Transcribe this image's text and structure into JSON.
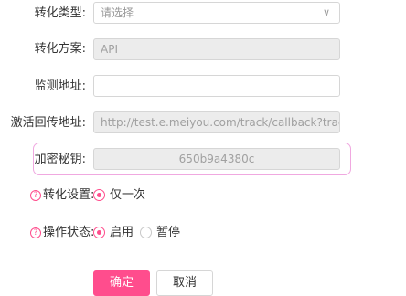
{
  "form": {
    "conversion_type": {
      "label": "转化类型:",
      "placeholder": "请选择"
    },
    "conversion_plan": {
      "label": "转化方案:",
      "value": "API"
    },
    "monitor_url": {
      "label": "监测地址:",
      "value": ""
    },
    "callback_url": {
      "label": "激活回传地址:",
      "value": "http://test.e.meiyou.com/track/callback?track_id={TRACK_"
    },
    "encryption_key": {
      "label": "加密秘钥:",
      "value": "650b9a4380c"
    },
    "conversion_setting": {
      "label": "转化设置:",
      "options": [
        "仅一次"
      ],
      "selected": "仅一次"
    },
    "operation_status": {
      "label": "操作状态:",
      "options": [
        "启用",
        "暂停"
      ],
      "selected": "启用"
    }
  },
  "buttons": {
    "confirm": "确定",
    "cancel": "取消"
  },
  "icons": {
    "help": "question-circle-icon",
    "dropdown": "chevron-down-icon"
  },
  "colors": {
    "accent": "#ff4d8d",
    "highlight_border": "#f0a8e0",
    "disabled_bg": "#ececec"
  }
}
